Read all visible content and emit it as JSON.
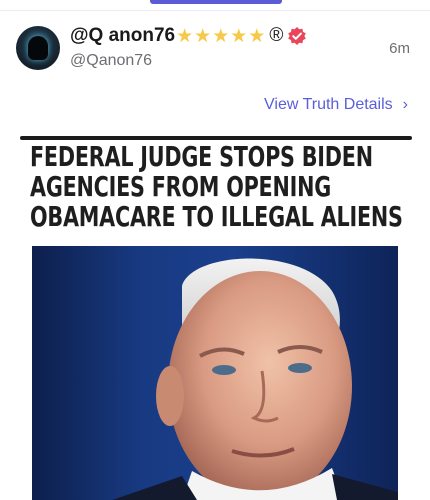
{
  "post": {
    "display_name": "@Q anon76",
    "stars": [
      "★",
      "★",
      "★",
      "★",
      "★"
    ],
    "registered_mark": "®",
    "handle": "@Qanon76",
    "time_ago": "6m",
    "view_details_label": "View Truth Details",
    "view_details_chevron": "›"
  },
  "image": {
    "headline_lines": [
      "FEDERAL JUDGE STOPS BIDEN",
      "AGENCIES FROM OPENING",
      "OBAMACARE TO ILLEGAL ALIENS"
    ]
  },
  "icons": {
    "verified": "verified-badge-icon",
    "chevron": "chevron-right-icon"
  },
  "colors": {
    "accent": "#5a5fd9",
    "star": "#f7c948",
    "verified": "#e8465b"
  }
}
